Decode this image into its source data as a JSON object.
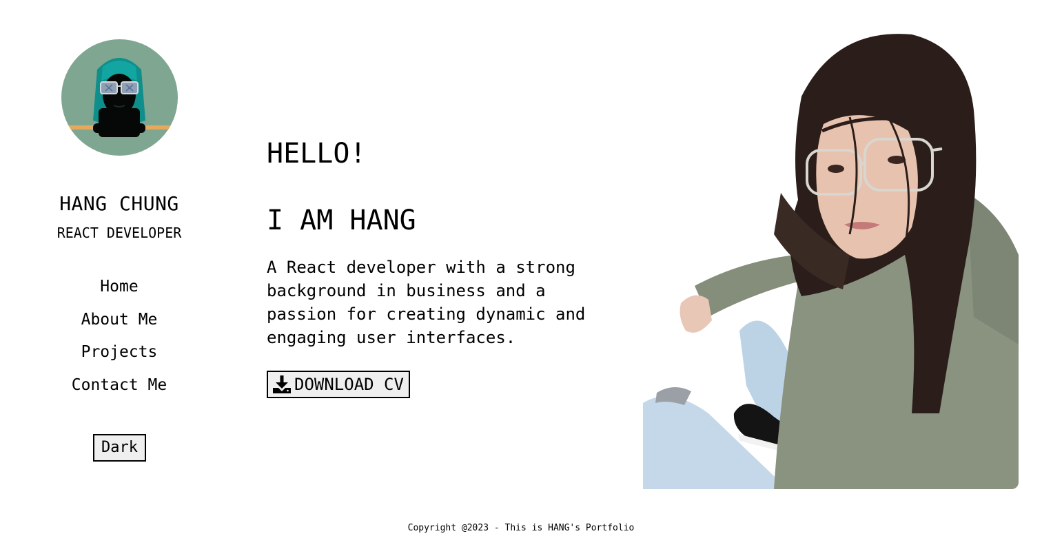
{
  "profile": {
    "name": "HANG CHUNG",
    "role": "REACT DEVELOPER"
  },
  "nav": {
    "items": [
      {
        "label": "Home"
      },
      {
        "label": "About Me"
      },
      {
        "label": "Projects"
      },
      {
        "label": "Contact Me"
      }
    ]
  },
  "theme_toggle": {
    "label": "Dark"
  },
  "hero": {
    "greeting": "HELLO!",
    "headline": "I AM HANG",
    "description": "A React developer with a strong background in business and a passion for creating dynamic and engaging user interfaces.",
    "cv_button": {
      "label": "DOWNLOAD CV",
      "icon": "download-icon"
    }
  },
  "footer": {
    "copyright": "Copyright @2023 - This is HANG's Portfolio"
  },
  "icons": {
    "avatar": "cartoon-avatar-icon",
    "download": "download-icon"
  },
  "colors": {
    "background": "#ffffff",
    "text": "#000000",
    "button_bg": "#efefef",
    "avatar_bg": "#7fa690",
    "avatar_hair": "#0f8f8c",
    "avatar_stripe": "#e6a85a",
    "jacket": "#8a9280",
    "jeans": "#bcd3e6"
  }
}
